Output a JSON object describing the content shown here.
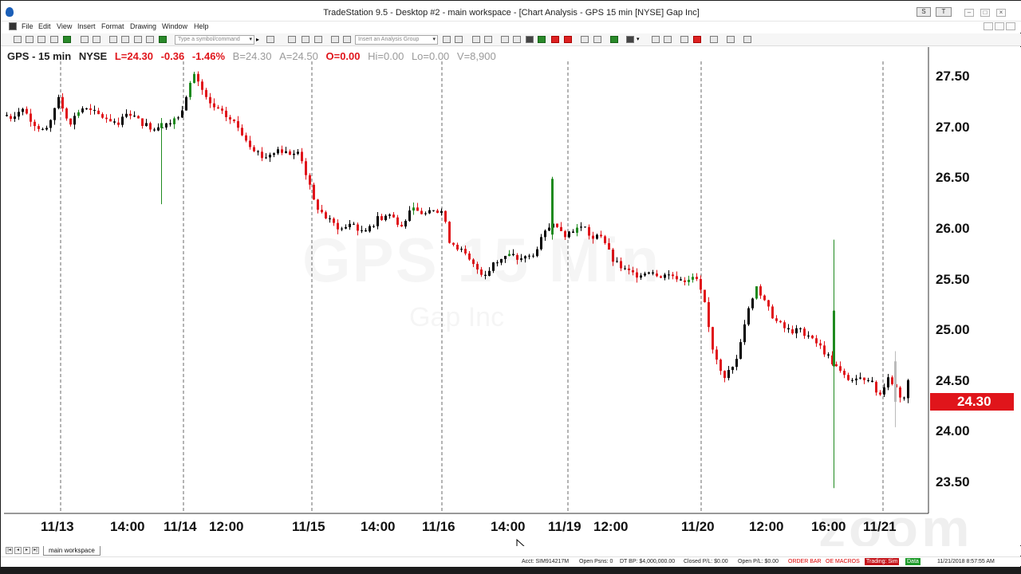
{
  "window": {
    "title": "TradeStation 9.5 - Desktop #2 - main workspace - [Chart Analysis - GPS 15 min [NYSE] Gap Inc]",
    "mini_buttons": [
      "S",
      "T"
    ],
    "controls": [
      "–",
      "□",
      "×"
    ]
  },
  "menu": [
    "File",
    "Edit",
    "View",
    "Insert",
    "Format",
    "Drawing",
    "Window",
    "Help"
  ],
  "toolbar": {
    "symbol_placeholder": "Type a symbol/command",
    "analysis_group_placeholder": "Insert an Analysis Group"
  },
  "status_line": {
    "symbol_interval": "GPS - 15 min",
    "exchange": "NYSE",
    "last": "L=24.30",
    "net_change": "-0.36",
    "pct_change": "-1.46%",
    "bid": "B=24.30",
    "ask": "A=24.50",
    "open": "O=0.00",
    "high": "Hi=0.00",
    "low": "Lo=0.00",
    "volume": "V=8,900"
  },
  "watermark": {
    "symbol": "GPS 15 Min",
    "name": "Gap Inc"
  },
  "zoom_watermark": "zoom",
  "colors": {
    "up": "#1f8a1f",
    "down": "#e0151b",
    "flat": "#000000",
    "last_tag": "#e0151b"
  },
  "chart_data": {
    "type": "candlestick",
    "interval": "15 min",
    "ylim": [
      23.2,
      27.8
    ],
    "price_axis_labels": [
      "27.50",
      "27.00",
      "26.50",
      "26.00",
      "25.50",
      "25.00",
      "24.50",
      "24.00",
      "23.50"
    ],
    "price_axis_values": [
      27.5,
      27.0,
      26.5,
      26.0,
      25.5,
      25.0,
      24.5,
      24.0,
      23.5
    ],
    "last_price": "24.30",
    "last_price_value": 24.3,
    "time_axis_labels": [
      "11/13",
      "14:00",
      "11/14",
      "12:00",
      "11/15",
      "14:00",
      "11/16",
      "14:00",
      "11/19",
      "12:00",
      "11/20",
      "12:00",
      "16:00",
      "11/21"
    ],
    "session_separators": [
      "11/13",
      "11/14",
      "11/15",
      "11/16",
      "11/19",
      "11/20",
      "11/21"
    ],
    "price_path": [
      [
        0,
        27.15
      ],
      [
        10,
        27.1
      ],
      [
        25,
        27.2
      ],
      [
        40,
        27.05
      ],
      [
        55,
        26.95
      ],
      [
        70,
        27.3
      ],
      [
        85,
        27.05
      ],
      [
        100,
        27.2
      ],
      [
        115,
        27.15
      ],
      [
        130,
        27.1
      ],
      [
        145,
        27.05
      ],
      [
        160,
        27.15
      ],
      [
        175,
        27.05
      ],
      [
        190,
        27.0
      ],
      [
        205,
        27.05
      ],
      [
        222,
        27.1
      ],
      [
        240,
        27.55
      ],
      [
        258,
        27.25
      ],
      [
        275,
        27.15
      ],
      [
        292,
        27.05
      ],
      [
        310,
        26.85
      ],
      [
        328,
        26.7
      ],
      [
        345,
        26.8
      ],
      [
        362,
        26.75
      ],
      [
        372,
        26.8
      ],
      [
        392,
        26.25
      ],
      [
        408,
        26.1
      ],
      [
        425,
        26.0
      ],
      [
        440,
        26.05
      ],
      [
        455,
        25.95
      ],
      [
        470,
        26.1
      ],
      [
        485,
        26.15
      ],
      [
        500,
        26.05
      ],
      [
        515,
        26.2
      ],
      [
        530,
        26.15
      ],
      [
        552,
        26.2
      ],
      [
        560,
        25.9
      ],
      [
        575,
        25.8
      ],
      [
        590,
        25.65
      ],
      [
        605,
        25.55
      ],
      [
        620,
        25.7
      ],
      [
        635,
        25.75
      ],
      [
        650,
        25.7
      ],
      [
        665,
        25.75
      ],
      [
        680,
        25.95
      ],
      [
        692,
        26.1
      ],
      [
        705,
        25.95
      ],
      [
        718,
        26.0
      ],
      [
        728,
        26.05
      ],
      [
        740,
        25.9
      ],
      [
        752,
        25.95
      ],
      [
        765,
        25.7
      ],
      [
        780,
        25.6
      ],
      [
        795,
        25.55
      ],
      [
        810,
        25.6
      ],
      [
        825,
        25.55
      ],
      [
        840,
        25.55
      ],
      [
        855,
        25.5
      ],
      [
        868,
        25.55
      ],
      [
        880,
        25.3
      ],
      [
        890,
        24.85
      ],
      [
        905,
        24.55
      ],
      [
        918,
        24.65
      ],
      [
        932,
        25.1
      ],
      [
        945,
        25.45
      ],
      [
        958,
        25.25
      ],
      [
        970,
        25.1
      ],
      [
        985,
        25.0
      ],
      [
        1000,
        25.0
      ],
      [
        1015,
        24.95
      ],
      [
        1030,
        24.8
      ],
      [
        1045,
        24.65
      ],
      [
        1055,
        24.55
      ],
      [
        1070,
        24.5
      ],
      [
        1085,
        24.55
      ],
      [
        1100,
        24.35
      ],
      [
        1110,
        24.55
      ],
      [
        1120,
        24.45
      ],
      [
        1130,
        24.3
      ],
      [
        1135,
        24.5
      ]
    ]
  },
  "tabs": {
    "workspace": "main workspace"
  },
  "statusbar": {
    "account": "Acct: SIM914217M",
    "open_positions": "Open Psns: 0",
    "dt_bp": "DT BP: $4,000,000.00",
    "closed_pl": "Closed P/L: $0.00",
    "open_pl": "Open P/L: $0.00",
    "order_bar": "ORDER BAR",
    "oe_macros": "OE MACROS",
    "trading": "Trading: Sim",
    "data": "Data",
    "datetime": "11/21/2018 8:57:55 AM"
  }
}
